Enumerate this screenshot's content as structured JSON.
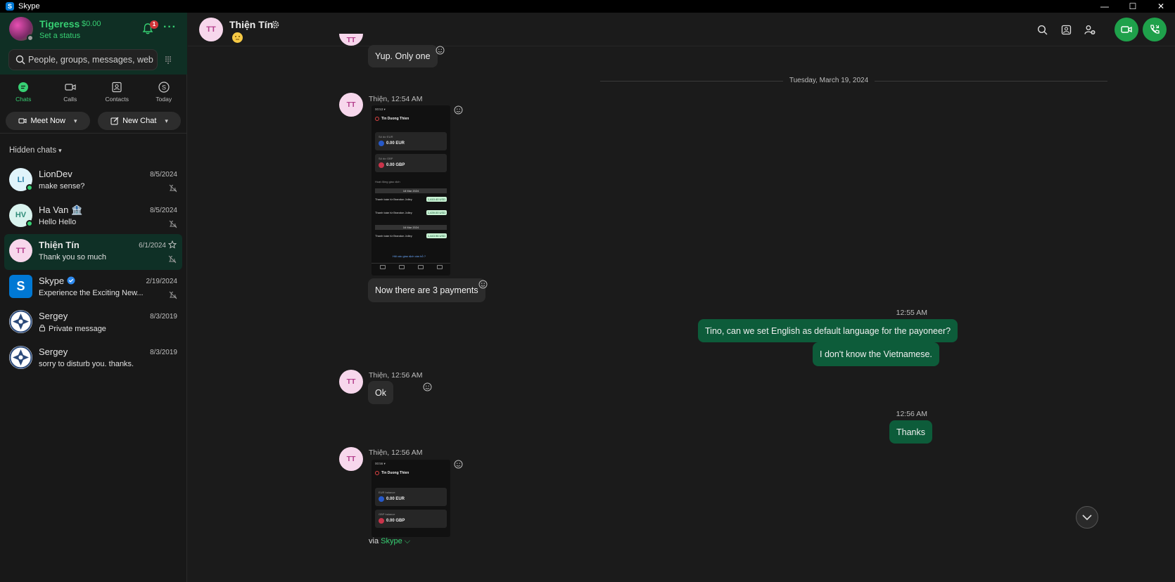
{
  "window": {
    "title": "Skype",
    "app_icon": "skype-logo",
    "controls": [
      "—",
      "☐",
      "✕"
    ]
  },
  "profile": {
    "name": "Tigeress",
    "balance": "$0.00",
    "status": "Set a status",
    "notification_count": "1"
  },
  "search": {
    "placeholder": "People, groups, messages, web"
  },
  "nav": {
    "chats": "Chats",
    "calls": "Calls",
    "contacts": "Contacts",
    "today": "Today"
  },
  "actions": {
    "meet_now": "Meet Now",
    "new_chat": "New Chat"
  },
  "hidden_chats": "Hidden chats",
  "chats": [
    {
      "initials": "LI",
      "name": "LionDev",
      "date": "8/5/2024",
      "message": "make sense?"
    },
    {
      "initials": "HV",
      "name": "Ha Van 🏦",
      "date": "8/5/2024",
      "message": "Hello Hello"
    },
    {
      "initials": "TT",
      "name": "Thiện Tín",
      "date": "6/1/2024",
      "message": "Thank you so much"
    },
    {
      "initials": "S",
      "name": "Skype",
      "date": "2/19/2024",
      "message": "Experience the Exciting New..."
    },
    {
      "initials": "",
      "name": "Sergey",
      "date": "8/3/2019",
      "message": "Private message"
    },
    {
      "initials": "",
      "name": "Sergey",
      "date": "8/3/2019",
      "message": "sorry to disturb you. thanks."
    }
  ],
  "conversation": {
    "contact_initials": "TT",
    "contact_name": "Thiện Tín",
    "date_separator": "Tuesday, March 19, 2024",
    "messages": {
      "m0": "Yup. Only one",
      "m1_meta": "Thiện, 12:54 AM",
      "m1_caption": "Now there are 3 payments",
      "m2_time": "12:55 AM",
      "m2a": "Tino, can we set English as default language for the payoneer?",
      "m2b": "I don't know the Vietnamese.",
      "m3_meta": "Thiện, 12:56 AM",
      "m3": "Ok",
      "m4_time": "12:56 AM",
      "m4": "Thanks",
      "m5_meta": "Thiện, 12:56 AM"
    },
    "via": "via",
    "via_link": "Skype"
  },
  "screenshot_1": {
    "time": "00:53 ▾",
    "title": "Tin Duong Thien",
    "card1_label": "Số dư EUR",
    "card1_value": "0.00 EUR",
    "card2_label": "Số dư GBP",
    "card2_value": "0.00 GBP",
    "section": "Hoạt động giao dịch",
    "date1": "18 Mar 2024",
    "row1": "Thanh toán từ Brandon Jolley",
    "row1_amt": "1,410.40 USD",
    "row2": "Thanh toán từ Brandon Jolley",
    "row2_amt": "1,439.00 USD",
    "date2": "16 Mar 2024",
    "row3": "Thanh toán từ Brandon Jolley",
    "row3_amt": "1,443.96 USD",
    "link": "Hỏi các giao dịch cần hỗ ?"
  },
  "screenshot_2": {
    "time": "00:56 ▾",
    "title": "Tin Duong Thien",
    "card1_label": "EUR balance",
    "card1_value": "0.00 EUR",
    "card2_label": "GBP balance",
    "card2_value": "0.00 GBP"
  }
}
